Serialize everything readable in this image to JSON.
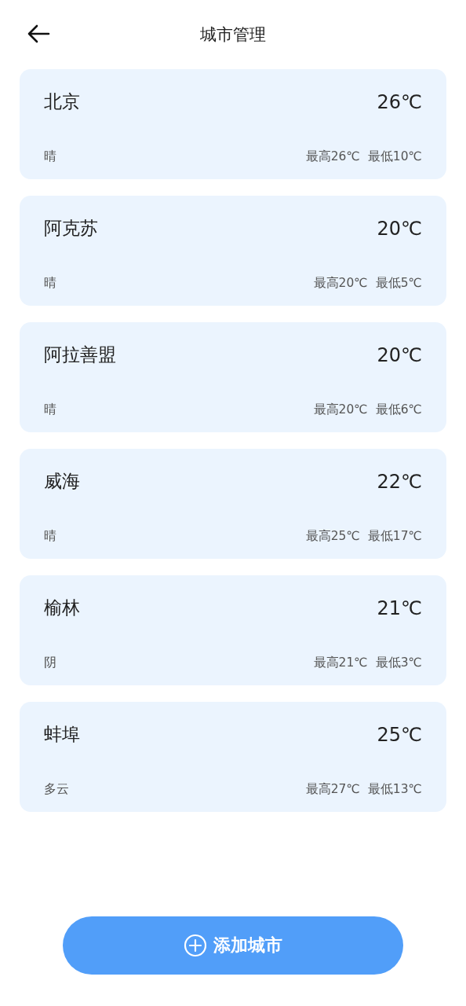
{
  "header": {
    "title": "城市管理"
  },
  "cities": [
    {
      "name": "北京",
      "temp": "26℃",
      "weather": "晴",
      "high": "最高26℃",
      "low": "最低10℃"
    },
    {
      "name": "阿克苏",
      "temp": "20℃",
      "weather": "晴",
      "high": "最高20℃",
      "low": "最低5℃"
    },
    {
      "name": "阿拉善盟",
      "temp": "20℃",
      "weather": "晴",
      "high": "最高20℃",
      "low": "最低6℃"
    },
    {
      "name": "威海",
      "temp": "22℃",
      "weather": "晴",
      "high": "最高25℃",
      "low": "最低17℃"
    },
    {
      "name": "榆林",
      "temp": "21℃",
      "weather": "阴",
      "high": "最高21℃",
      "low": "最低3℃"
    },
    {
      "name": "蚌埠",
      "temp": "25℃",
      "weather": "多云",
      "high": "最高27℃",
      "low": "最低13℃"
    }
  ],
  "add_button": {
    "label": "添加城市"
  }
}
